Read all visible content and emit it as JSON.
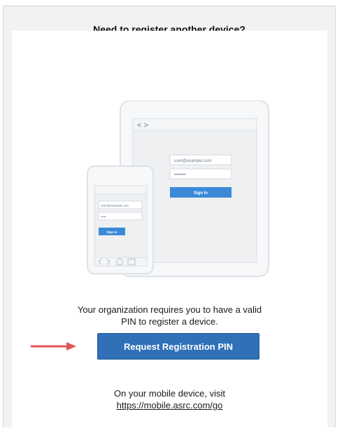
{
  "panel": {
    "title": "Need to register another device?"
  },
  "illustration": {
    "tablet_username": "user@example.com",
    "tablet_password": "••••••••",
    "tablet_sign_in": "Sign In",
    "phone_username": "user@example.com",
    "phone_password": "•••••",
    "phone_sign_in": "Sign In"
  },
  "message": {
    "line1": "Your organization requires you to have a valid",
    "line2": "PIN to register a device."
  },
  "request_button": {
    "label": "Request Registration PIN"
  },
  "mobile_note": {
    "line1": "On your mobile device, visit",
    "link": "https://mobile.asrc.com/go"
  },
  "colors": {
    "button": "#2f70b7",
    "arrow": "#e05555",
    "panel_background": "#f2f2f2"
  }
}
